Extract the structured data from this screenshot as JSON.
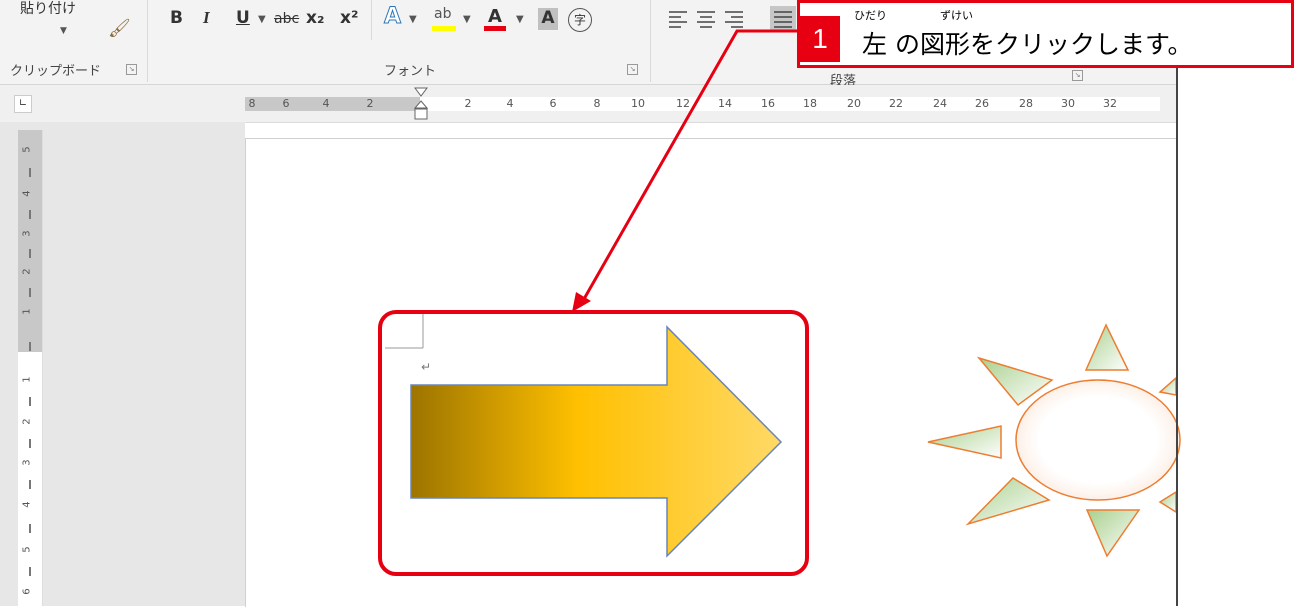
{
  "ribbon": {
    "clipboard": {
      "paste_label": "貼り付け",
      "group_label": "クリップボード"
    },
    "font": {
      "group_label": "フォント",
      "buttons": {
        "bold": "B",
        "italic": "I",
        "underline": "U",
        "strikethrough": "abc",
        "subscript": "x₂",
        "superscript": "x²",
        "text_effects": "A",
        "font_color": "A",
        "char_shading": "A",
        "enclosed_char": "字"
      }
    },
    "paragraph": {
      "group_label": "段落"
    }
  },
  "ruler": {
    "horizontal_ticks": [
      "8",
      "6",
      "4",
      "2",
      "2",
      "4",
      "6",
      "8",
      "10",
      "12",
      "14",
      "16",
      "18",
      "20",
      "22",
      "24",
      "26",
      "28",
      "30",
      "32"
    ],
    "vertical_ticks": [
      "5",
      "4",
      "3",
      "2",
      "1",
      "1",
      "2",
      "3",
      "4",
      "5",
      "6"
    ]
  },
  "callout": {
    "step_number": "1",
    "text": "左 の図形をクリックします。",
    "ruby_left": "ひだり",
    "ruby_shape": "ずけい"
  },
  "document": {
    "paragraph_mark": "↵"
  },
  "colors": {
    "highlight_red": "#e60012",
    "arrow_gradient_start": "#9c7400",
    "arrow_gradient_mid": "#ffc000",
    "arrow_gradient_end": "#ffd966",
    "sun_outline": "#ed7d31",
    "sun_ray_fill": "#a9d08e"
  }
}
